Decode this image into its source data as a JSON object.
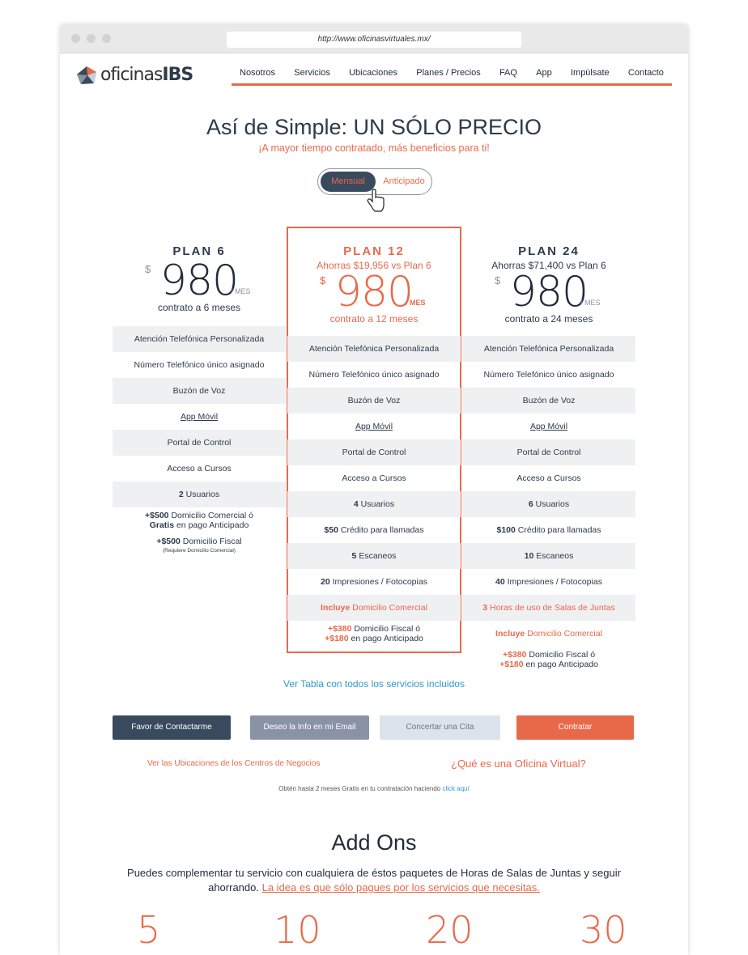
{
  "browser": {
    "url": "http://www.oficinasvirtuales.mx/"
  },
  "logo": {
    "prefix": "oficinas",
    "brand": "IBS"
  },
  "nav": [
    "Nosotros",
    "Servicios",
    "Ubicaciones",
    "Planes / Precios",
    "FAQ",
    "App",
    "Impúlsate",
    "Contacto"
  ],
  "hero": {
    "title": "Así de Simple: UN SÓLO PRECIO",
    "subtitle": "¡A mayor tiempo contratado, más beneficios para ti!"
  },
  "toggle": {
    "monthly": "Mensual",
    "advance": "Anticipado"
  },
  "plans": [
    {
      "name": "PLAN 6",
      "savings": "",
      "currency": "$",
      "price": "980",
      "per": "/ MES",
      "contract": "contrato a 6 meses",
      "features": [
        {
          "bold": "",
          "text": "Atención Telefónica Personalizada"
        },
        {
          "bold": "",
          "text": "Número Telefónico único asignado"
        },
        {
          "bold": "",
          "text": "Buzón de Voz"
        },
        {
          "bold": "",
          "text": "App Móvil"
        },
        {
          "bold": "",
          "text": "Portal de Control"
        },
        {
          "bold": "",
          "text": "Acceso a Cursos"
        },
        {
          "bold": "2",
          "text": "Usuarios"
        },
        {
          "bold": "+$500",
          "text": "Domicilio Comercial ó",
          "bold2": "Gratis",
          "text2": "en pago Anticipado"
        },
        {
          "bold": "+$500",
          "text": "Domicilio Fiscal",
          "note": "(Requiere Domicilio Comercial)"
        }
      ]
    },
    {
      "name": "PLAN 12",
      "savings": "Ahorras $19,956 vs Plan 6",
      "currency": "$",
      "price": "980",
      "per": "/ MES",
      "contract": "contrato a 12 meses",
      "features": [
        {
          "bold": "",
          "text": "Atención Telefónica Personalizada"
        },
        {
          "bold": "",
          "text": "Número Telefónico único asignado"
        },
        {
          "bold": "",
          "text": "Buzón de Voz"
        },
        {
          "bold": "",
          "text": "App Móvil"
        },
        {
          "bold": "",
          "text": "Portal de Control"
        },
        {
          "bold": "",
          "text": "Acceso a Cursos"
        },
        {
          "bold": "4",
          "text": "Usuarios"
        },
        {
          "bold": "$50",
          "text": "Crédito para llamadas"
        },
        {
          "bold": "5",
          "text": "Escaneos"
        },
        {
          "bold": "20",
          "text": "Impresiones / Fotocopias"
        },
        {
          "bold": "Incluye",
          "text": "Domicilio Comercial"
        },
        {
          "bold": "+$380",
          "text": "Domicilio Fiscal ó",
          "bold2": "+$180",
          "text2": "en pago Anticipado"
        }
      ]
    },
    {
      "name": "PLAN 24",
      "savings": "Ahorras $71,400 vs Plan 6",
      "currency": "$",
      "price": "980",
      "per": "/ MES",
      "contract": "contrato a 24 meses",
      "features": [
        {
          "bold": "",
          "text": "Atención Telefónica Personalizada"
        },
        {
          "bold": "",
          "text": "Número Telefónico único asignado"
        },
        {
          "bold": "",
          "text": "Buzón de Voz"
        },
        {
          "bold": "",
          "text": "App Móvil"
        },
        {
          "bold": "",
          "text": "Portal de Control"
        },
        {
          "bold": "",
          "text": "Acceso a Cursos"
        },
        {
          "bold": "6",
          "text": "Usuarios"
        },
        {
          "bold": "$100",
          "text": "Crédito para llamadas"
        },
        {
          "bold": "10",
          "text": "Escaneos"
        },
        {
          "bold": "40",
          "text": "Impresiones / Fotocopias"
        },
        {
          "bold": "3",
          "text": "Horas de uso de Salas de Juntas"
        },
        {
          "bold": "Incluye",
          "text": "Domicilio Comercial"
        },
        {
          "bold": "+$380",
          "text": "Domicilio Fiscal ó",
          "bold2": "+$180",
          "text2": "en pago Anticipado"
        }
      ]
    }
  ],
  "table_link": "Ver Tabla con todos los servicios incluidos",
  "buttons": {
    "contact": "Favor de Contactarme",
    "email": "Deseo la Info en mi Email",
    "appointment": "Concertar una Cita",
    "hire": "Contratar"
  },
  "links": {
    "locations": "Ver las Ubicaciones de los Centros de Negocios",
    "what_is": "¿Qué es una Oficina Virtual?",
    "promo_text": "Obtén hasta 2 meses Gratis en tu contratación haciendo",
    "promo_link": "click aquí"
  },
  "addons": {
    "title": "Add Ons",
    "desc": "Puedes complementar tu servicio con cualquiera de éstos paquetes de Horas de Salas de Juntas y seguir ahorrando.",
    "desc_link": "La idea es que sólo pagues por los servicios que necesitas.",
    "numbers": [
      "5",
      "10",
      "20",
      "30"
    ]
  },
  "colors": {
    "accent": "#e8694a",
    "navy": "#2d3a4a",
    "link": "#3399cc"
  }
}
